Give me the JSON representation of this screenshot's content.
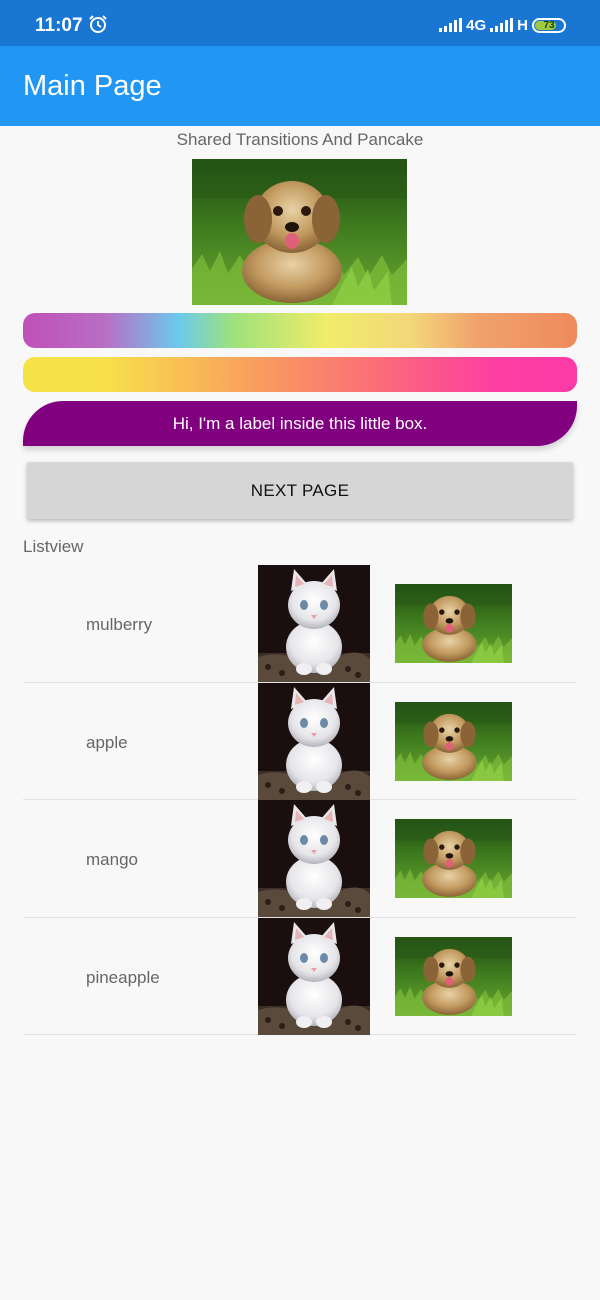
{
  "status_bar": {
    "time": "11:07",
    "network": "4G",
    "network2": "H",
    "battery": "73",
    "alarm_icon": "alarm-clock-icon"
  },
  "app_bar": {
    "title": "Main Page"
  },
  "main": {
    "subtitle": "Shared Transitions And Pancake",
    "label_box_text": "Hi, I'm a label inside this little box.",
    "next_button_label": "NEXT PAGE",
    "listview_title": "Listview"
  },
  "list_items": [
    {
      "label": "mulberry"
    },
    {
      "label": "apple"
    },
    {
      "label": "mango"
    },
    {
      "label": "pineapple"
    }
  ],
  "colors": {
    "status_bar": "#1976d2",
    "app_bar": "#2196f3",
    "label_box": "#800080",
    "button": "#d6d6d6"
  }
}
